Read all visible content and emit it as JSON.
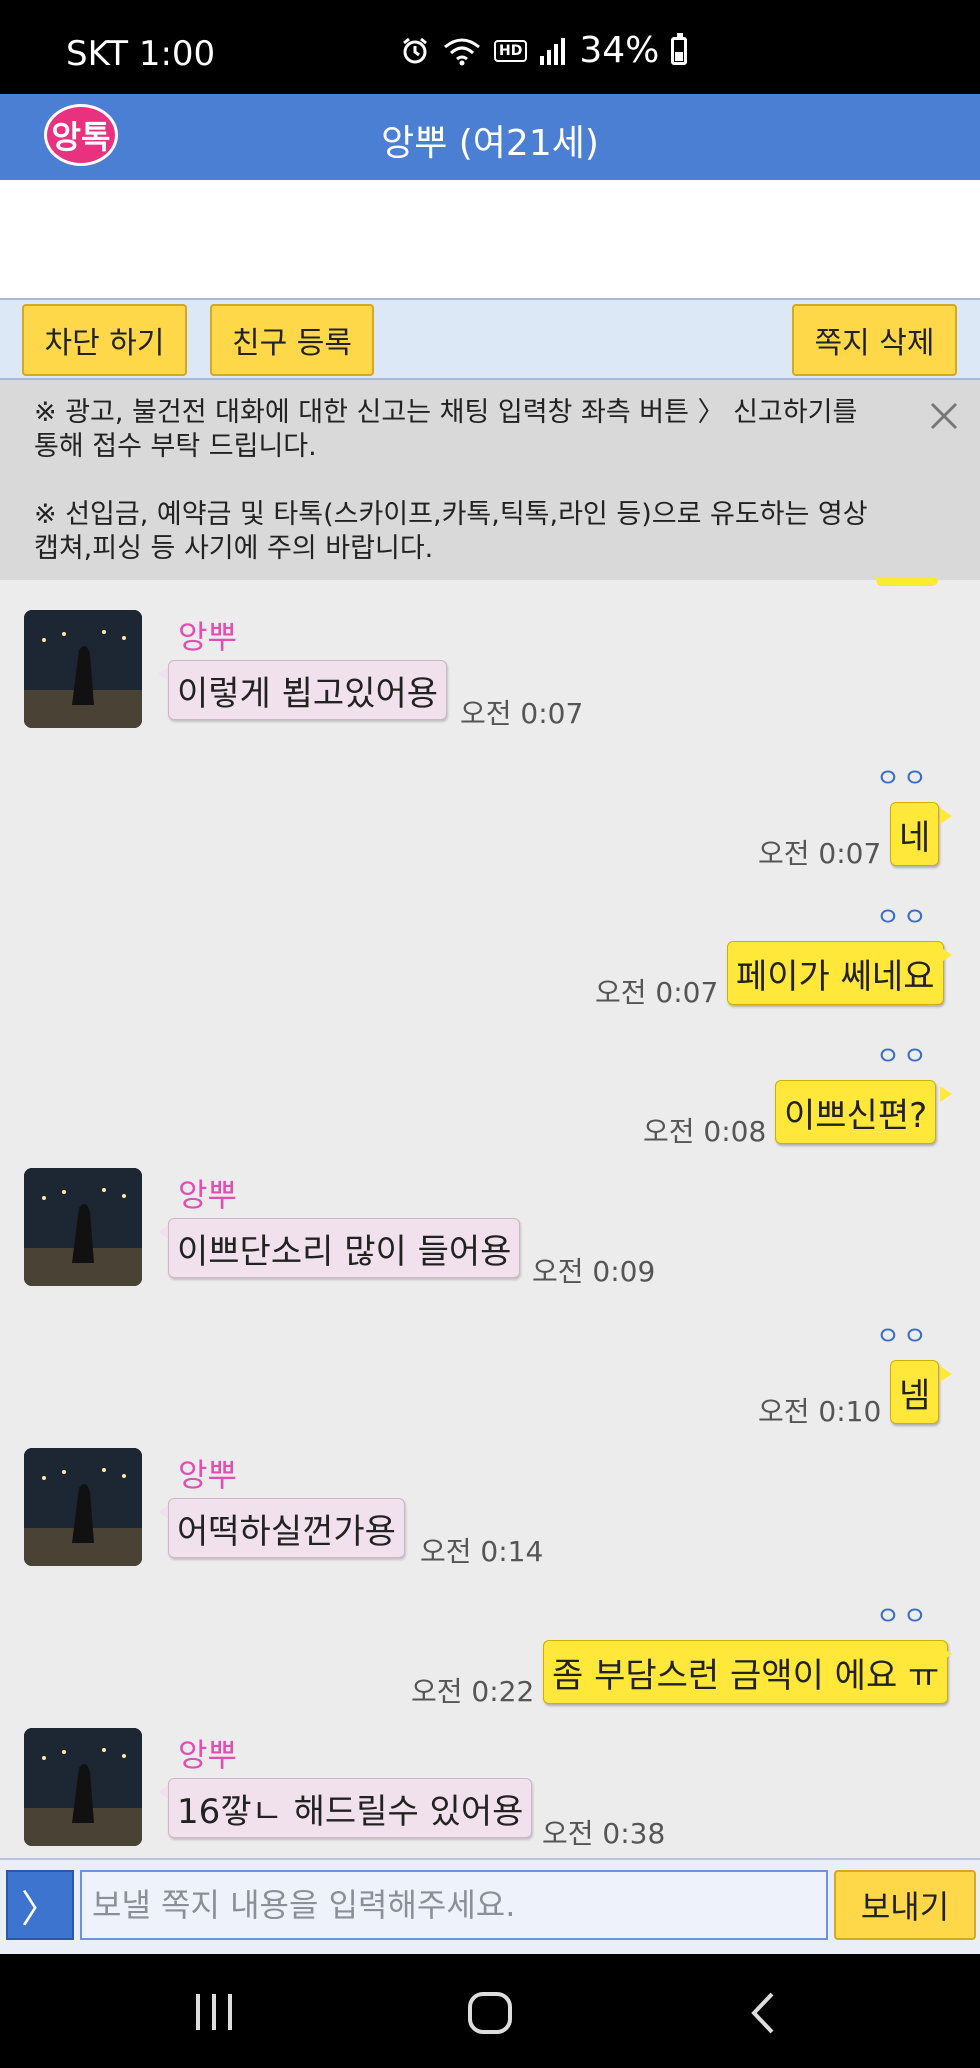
{
  "status_bar": {
    "carrier_time": "SKT 1:00",
    "hd_label": "HD",
    "battery": "34%"
  },
  "header": {
    "logo_text": "앙톡",
    "title": "앙뿌 (여21세)"
  },
  "actions": {
    "block": "차단 하기",
    "add_friend": "친구 등록",
    "delete_note": "쪽지 삭제"
  },
  "notice": {
    "line1": "※ 광고, 불건전 대화에 대한 신고는 채팅 입력창 좌측 버튼 〉 신고하기를 통해 접수 부탁 드립니다.",
    "line2": "※ 선입금, 예약금 및 타톡(스카이프,카톡,틱톡,라인 등)으로 유도하는 영상캡쳐,피싱 등 사기에 주의 바랍니다."
  },
  "messages": [
    {
      "dir": "in",
      "sender": "앙뿌",
      "text": "이렇게 뵙고있어용",
      "time": "오전 0:07"
    },
    {
      "dir": "out",
      "read": "ㅇㅇ",
      "text": "네",
      "time": "오전 0:07"
    },
    {
      "dir": "out",
      "read": "ㅇㅇ",
      "text": "페이가 쎄네요",
      "time": "오전 0:07"
    },
    {
      "dir": "out",
      "read": "ㅇㅇ",
      "text": "이쁘신편?",
      "time": "오전 0:08"
    },
    {
      "dir": "in",
      "sender": "앙뿌",
      "text": "이쁘단소리 많이 들어용",
      "time": "오전 0:09"
    },
    {
      "dir": "out",
      "read": "ㅇㅇ",
      "text": "넴",
      "time": "오전 0:10"
    },
    {
      "dir": "in",
      "sender": "앙뿌",
      "text": "어떡하실껀가용",
      "time": "오전 0:14"
    },
    {
      "dir": "out",
      "read": "ㅇㅇ",
      "text": "좀 부담스런 금액이 에요 ㅠ",
      "time": "오전 0:22"
    },
    {
      "dir": "in",
      "sender": "앙뿌",
      "text": "16깧ㄴ 해드릴수 있어용",
      "time": "오전 0:38"
    }
  ],
  "input": {
    "menu_glyph": "〉",
    "placeholder": "보낼 쪽지 내용을 입력해주세요.",
    "send": "보내기"
  },
  "icons": {
    "alarm": "alarm-icon",
    "wifi": "wifi-icon",
    "signal": "signal-icon",
    "battery": "battery-icon",
    "close": "close-icon",
    "nav_recents": "recents-icon",
    "nav_home": "home-icon",
    "nav_back": "back-icon"
  },
  "colors": {
    "appbar": "#4a7fd4",
    "incoming_bubble": "#f0e1ed",
    "outgoing_bubble": "#ffe83a",
    "sender_name": "#e04fb1",
    "read_mark": "#3a6dc6"
  }
}
